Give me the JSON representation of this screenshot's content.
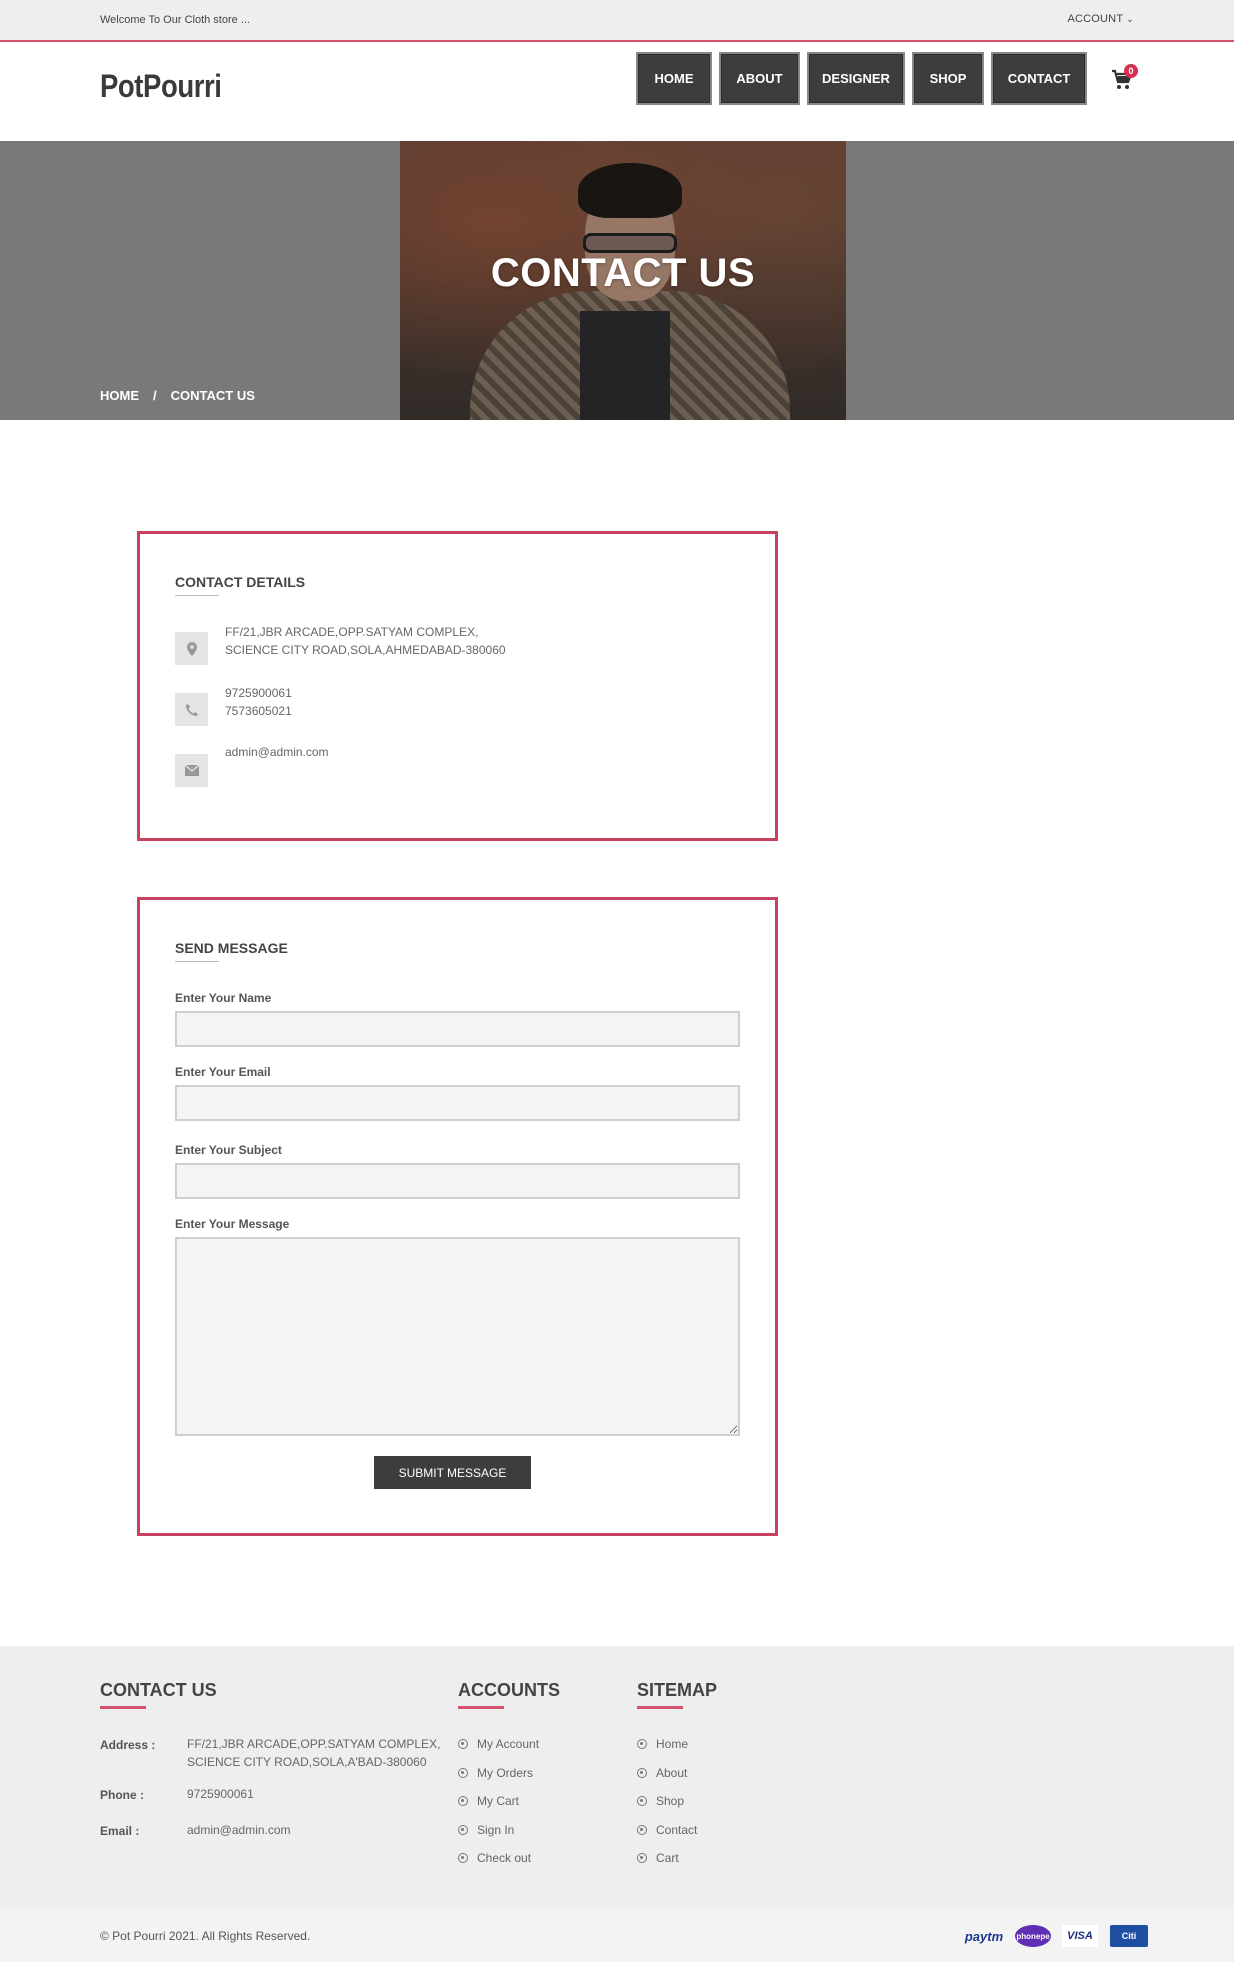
{
  "topbar": {
    "welcome": "Welcome To Our Cloth store ...",
    "account": "ACCOUNT"
  },
  "header": {
    "logo": "PotPourri",
    "nav": [
      "HOME",
      "ABOUT",
      "DESIGNER",
      "SHOP",
      "CONTACT"
    ],
    "cart_count": "0"
  },
  "hero": {
    "title": "CONTACT US",
    "breadcrumb": [
      "HOME",
      "/",
      "CONTACT US"
    ]
  },
  "contact_details": {
    "title": "CONTACT DETAILS",
    "address": [
      "FF/21,JBR ARCADE,OPP.SATYAM COMPLEX,",
      "SCIENCE CITY ROAD,SOLA,AHMEDABAD-380060"
    ],
    "phones": [
      "9725900061",
      "7573605021"
    ],
    "email": "admin@admin.com"
  },
  "send_message": {
    "title": "SEND MESSAGE",
    "name_label": "Enter Your Name",
    "email_label": "Enter Your Email",
    "subject_label": "Enter Your Subject",
    "message_label": "Enter Your Message",
    "name_value": "",
    "email_value": "",
    "subject_value": "",
    "message_value": "",
    "submit": "SUBMIT MESSAGE"
  },
  "footer": {
    "contact_heading": "CONTACT US",
    "address_label": "Address :",
    "address_value": [
      "FF/21,JBR ARCADE,OPP.SATYAM COMPLEX,",
      "SCIENCE CITY ROAD,SOLA,A'BAD-380060"
    ],
    "phone_label": "Phone :",
    "phone_value": "9725900061",
    "email_label": "Email :",
    "email_value": "admin@admin.com",
    "accounts_heading": "ACCOUNTS",
    "accounts_links": [
      "My Account",
      "My Orders",
      "My Cart",
      "Sign In",
      "Check out"
    ],
    "sitemap_heading": "SITEMAP",
    "sitemap_links": [
      "Home",
      "About",
      "Shop",
      "Contact",
      "Cart"
    ]
  },
  "bottombar": {
    "copyright": "© Pot Pourri 2021. All Rights Reserved.",
    "payments": [
      "paytm",
      "phonepe",
      "VISA",
      "Citi"
    ]
  },
  "colors": {
    "accent": "#d4526e",
    "box_border": "#c8415e",
    "dark_button": "#3d3d3d"
  }
}
